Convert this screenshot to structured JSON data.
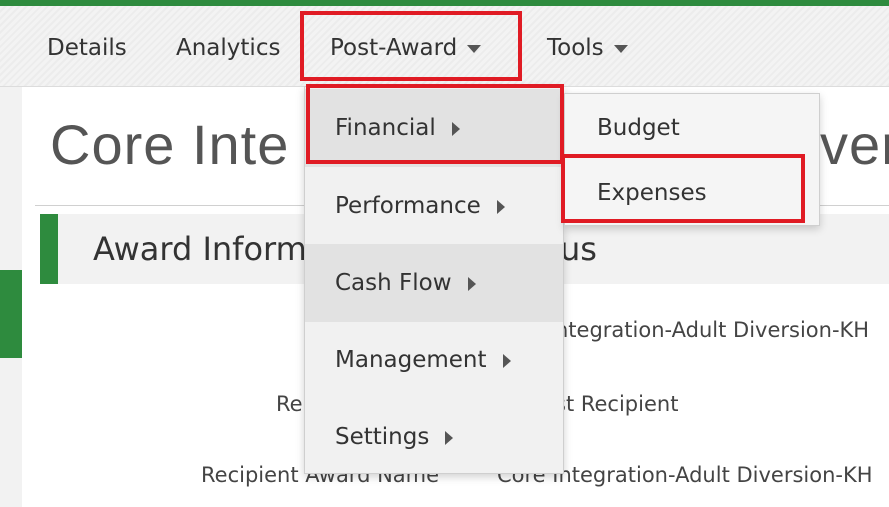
{
  "nav": {
    "items": [
      {
        "label": "Details"
      },
      {
        "label": "Analytics"
      },
      {
        "label": "Post-Award"
      },
      {
        "label": "Tools"
      }
    ]
  },
  "page": {
    "title": "Core Inte",
    "title_tail": "ver"
  },
  "section": {
    "title": "Award Inform",
    "title_tail": "us"
  },
  "fields": [
    {
      "label": "",
      "value": "ntegration-Adult Diversion-KH"
    },
    {
      "label": "Re",
      "value": "st Recipient"
    },
    {
      "label": "Recipient Award Name",
      "value": "Core Integration-Adult Diversion-KH"
    }
  ],
  "dropdown": {
    "items": [
      {
        "label": "Financial"
      },
      {
        "label": "Performance"
      },
      {
        "label": "Cash Flow"
      },
      {
        "label": "Management"
      },
      {
        "label": "Settings"
      }
    ]
  },
  "submenu": {
    "items": [
      {
        "label": "Budget"
      },
      {
        "label": "Expenses"
      }
    ]
  },
  "colors": {
    "accent_green": "#2e8b3e",
    "highlight_red": "#e01b24"
  },
  "icons": [
    "caret-down-icon",
    "caret-right-icon"
  ]
}
